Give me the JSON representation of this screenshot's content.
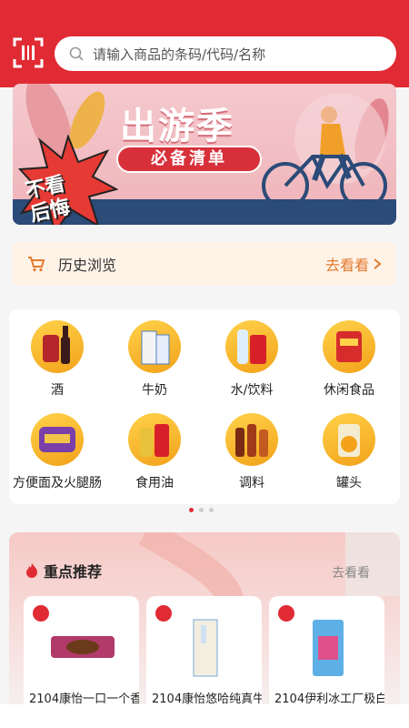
{
  "search": {
    "placeholder": "请输入商品的条码/代码/名称"
  },
  "banner": {
    "title": "出游季",
    "subtitle": "必备清单",
    "badge": "不看后悔"
  },
  "history": {
    "label": "历史浏览",
    "more": "去看看"
  },
  "categories": [
    {
      "label": "酒"
    },
    {
      "label": "牛奶"
    },
    {
      "label": "水/饮料"
    },
    {
      "label": "休闲食品"
    },
    {
      "label": "方便面及火腿肠"
    },
    {
      "label": "食用油"
    },
    {
      "label": "调料"
    },
    {
      "label": "罐头"
    }
  ],
  "pager": {
    "count": 3,
    "active": 0
  },
  "featured": {
    "title": "重点推荐",
    "more": "去看看",
    "products": [
      {
        "name": "2104康怡一口一个香"
      },
      {
        "name": "2104康怡悠哈纯真牛"
      },
      {
        "name": "2104伊利冰工厂极白"
      }
    ]
  },
  "colors": {
    "brand": "#e12b34",
    "accent": "#e37a2c"
  }
}
